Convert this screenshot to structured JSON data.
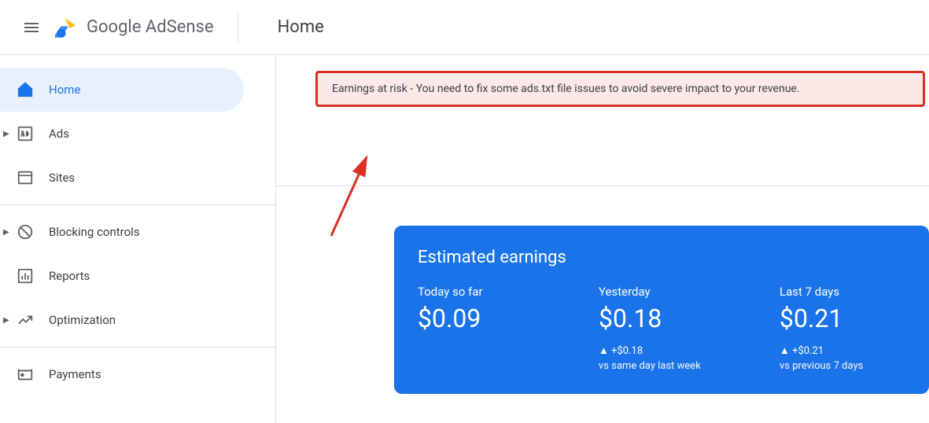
{
  "header": {
    "brand_google": "Google",
    "brand_product": " AdSense",
    "page_title": "Home"
  },
  "sidebar": {
    "items": [
      {
        "label": "Home"
      },
      {
        "label": "Ads"
      },
      {
        "label": "Sites"
      },
      {
        "label": "Blocking controls"
      },
      {
        "label": "Reports"
      },
      {
        "label": "Optimization"
      },
      {
        "label": "Payments"
      }
    ]
  },
  "alert": {
    "text": "Earnings at risk - You need to fix some ads.txt file issues to avoid severe impact to your revenue."
  },
  "earnings": {
    "title": "Estimated earnings",
    "today": {
      "label": "Today so far",
      "value": "$0.09"
    },
    "yesterday": {
      "label": "Yesterday",
      "value": "$0.18",
      "delta": "▲ +$0.18",
      "compare": "vs same day last week"
    },
    "week": {
      "label": "Last 7 days",
      "value": "$0.21",
      "delta": "▲ +$0.21",
      "compare": "vs previous 7 days"
    }
  }
}
